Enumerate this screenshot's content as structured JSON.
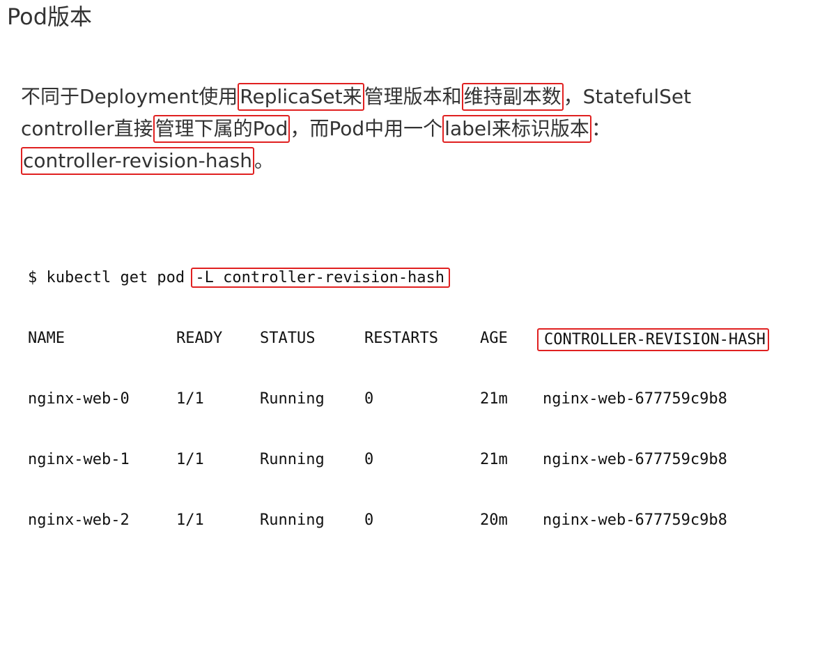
{
  "title": "Pod版本",
  "paragraph": {
    "line1": {
      "t1": "不同于Deployment使用",
      "h1": "ReplicaSet来",
      "t2": "管理版本和",
      "h2": "维持副本数",
      "t3": "，StatefulSet"
    },
    "line2": {
      "t1": "controller直接",
      "h1": "管理下属的Pod",
      "t2": "，而Pod中用一个",
      "h2": "label来标识版本",
      "t3": "："
    },
    "line3": {
      "h1": "controller-revision-hash",
      "t1": "。"
    }
  },
  "terminal": {
    "command_prefix": "$ kubectl get pod ",
    "command_flag": "-L controller-revision-hash",
    "headers": [
      "NAME",
      "READY",
      "STATUS",
      "RESTARTS",
      "AGE",
      "CONTROLLER-REVISION-HASH"
    ],
    "rows": [
      [
        "nginx-web-0",
        "1/1",
        "Running",
        "0",
        "21m",
        "nginx-web-677759c9b8"
      ],
      [
        "nginx-web-1",
        "1/1",
        "Running",
        "0",
        "21m",
        "nginx-web-677759c9b8"
      ],
      [
        "nginx-web-2",
        "1/1",
        "Running",
        "0",
        "20m",
        "nginx-web-677759c9b8"
      ]
    ]
  },
  "colors": {
    "highlight_border": "#e02020",
    "text": "#333333"
  }
}
